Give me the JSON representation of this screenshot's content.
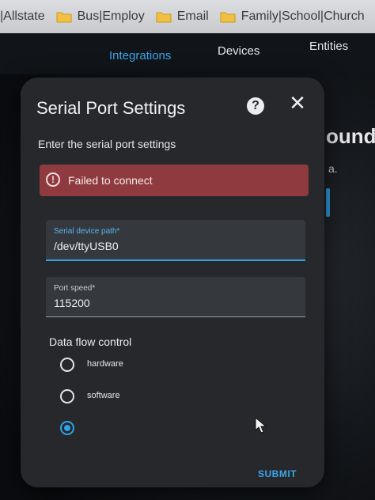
{
  "bookmarks": [
    {
      "label": "|Allstate",
      "icon": "none"
    },
    {
      "label": "Bus|Employ",
      "icon": "folder-icon"
    },
    {
      "label": "Email",
      "icon": "folder-icon"
    },
    {
      "label": "Family|School|Church",
      "icon": "folder-icon"
    }
  ],
  "header": {
    "tabs": [
      {
        "label": "Integrations",
        "active": true
      },
      {
        "label": "Devices",
        "active": false
      },
      {
        "label": "Entities",
        "active": false
      }
    ]
  },
  "background": {
    "heading_fragment": "ound",
    "text_fragment": "a."
  },
  "dialog": {
    "title": "Serial Port Settings",
    "help_icon_glyph": "?",
    "close_icon_glyph": "✕",
    "description": "Enter the serial port settings",
    "error": {
      "icon_glyph": "!",
      "message": "Failed to connect"
    },
    "serial_path": {
      "label": "Serial device path*",
      "value": "/dev/ttyUSB0"
    },
    "port_speed": {
      "label": "Port speed*",
      "value": "115200"
    },
    "flow_control": {
      "label": "Data flow control",
      "options": [
        {
          "label": "hardware",
          "checked": false
        },
        {
          "label": "software",
          "checked": false
        },
        {
          "label": "",
          "checked": true
        }
      ]
    },
    "submit_label": "SUBMIT"
  },
  "colors": {
    "accent": "#2fa3e6",
    "error_bg": "#8f3a3f",
    "dialog_bg": "#26282c"
  }
}
